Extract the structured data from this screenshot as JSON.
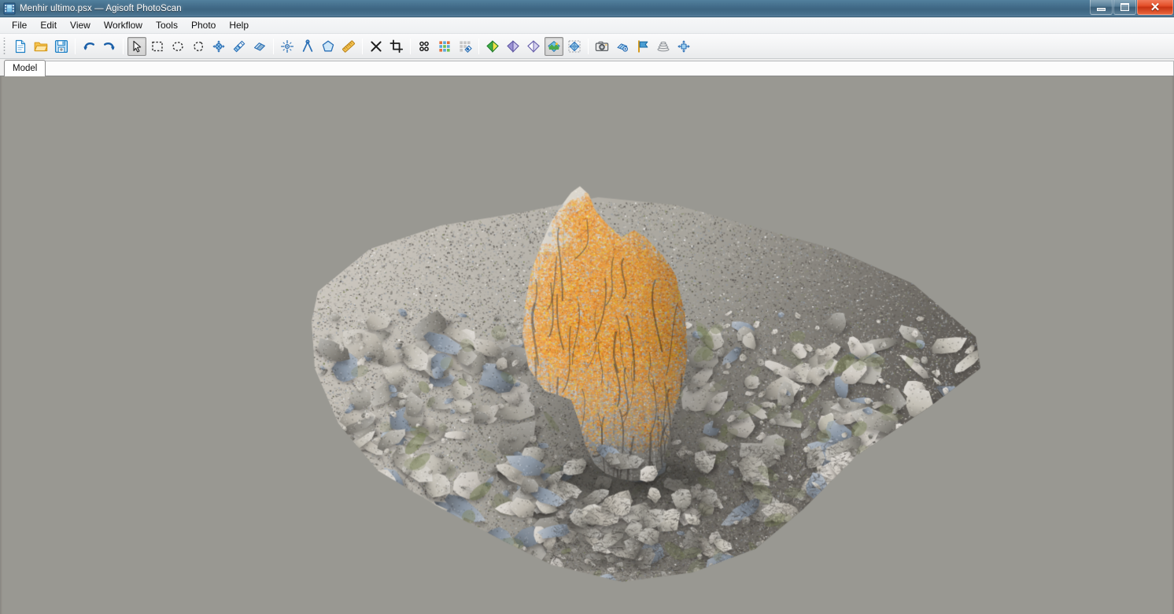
{
  "window": {
    "title": "Menhir ultimo.psx — Agisoft PhotoScan",
    "app_icon": "photoscan-document-icon",
    "controls": {
      "minimize": "Minimize",
      "maximize": "Restore",
      "close": "Close",
      "close_glyph": "✕"
    },
    "accent_title_bar": "#46718e",
    "accent_close": "#c73313"
  },
  "menu": {
    "items": [
      {
        "label": "File",
        "name": "menu-file"
      },
      {
        "label": "Edit",
        "name": "menu-edit"
      },
      {
        "label": "View",
        "name": "menu-view"
      },
      {
        "label": "Workflow",
        "name": "menu-workflow"
      },
      {
        "label": "Tools",
        "name": "menu-tools"
      },
      {
        "label": "Photo",
        "name": "menu-photo"
      },
      {
        "label": "Help",
        "name": "menu-help"
      }
    ]
  },
  "toolbar": {
    "groups": [
      {
        "name": "file-group",
        "buttons": [
          {
            "icon": "new-document-icon",
            "tooltip": "New"
          },
          {
            "icon": "open-folder-icon",
            "tooltip": "Open"
          },
          {
            "icon": "save-floppy-icon",
            "tooltip": "Save"
          }
        ]
      },
      {
        "name": "history-group",
        "buttons": [
          {
            "icon": "undo-arrow-icon",
            "tooltip": "Undo"
          },
          {
            "icon": "redo-arrow-icon",
            "tooltip": "Redo"
          }
        ]
      },
      {
        "name": "selection-group",
        "buttons": [
          {
            "icon": "arrow-cursor-icon",
            "tooltip": "Navigation",
            "active": true
          },
          {
            "icon": "rectangle-selection-icon",
            "tooltip": "Rectangle Selection"
          },
          {
            "icon": "circle-selection-icon",
            "tooltip": "Circle Selection"
          },
          {
            "icon": "free-form-selection-icon",
            "tooltip": "Free-Form Selection"
          },
          {
            "icon": "move-object-icon",
            "tooltip": "Move Object"
          },
          {
            "icon": "rotate-object-icon",
            "tooltip": "Rotate Object"
          },
          {
            "icon": "scale-object-icon",
            "tooltip": "Scale Object"
          }
        ]
      },
      {
        "name": "marker-group",
        "buttons": [
          {
            "icon": "add-marker-icon",
            "tooltip": "Place Marker"
          },
          {
            "icon": "add-scalebar-icon",
            "tooltip": "Create Scale Bar"
          },
          {
            "icon": "polygon-shape-icon",
            "tooltip": "Draw Polygon"
          },
          {
            "icon": "ruler-measure-icon",
            "tooltip": "Measure"
          }
        ]
      },
      {
        "name": "edit-group",
        "buttons": [
          {
            "icon": "delete-x-icon",
            "tooltip": "Delete Selection"
          },
          {
            "icon": "crop-selection-icon",
            "tooltip": "Crop Selection"
          }
        ]
      },
      {
        "name": "photos-group",
        "buttons": [
          {
            "icon": "show-cameras-icon",
            "tooltip": "Show Cameras"
          },
          {
            "icon": "show-aligned-photos-icon",
            "tooltip": "Show Aligned Photos"
          },
          {
            "icon": "show-matches-icon",
            "tooltip": "Show Matches"
          }
        ]
      },
      {
        "name": "view-mode-group",
        "buttons": [
          {
            "icon": "point-cloud-diamond-icon",
            "tooltip": "Point Cloud",
            "color": "#35a046"
          },
          {
            "icon": "dense-cloud-diamond-icon",
            "tooltip": "Dense Cloud",
            "color": "#8f86c9"
          },
          {
            "icon": "mesh-wireframe-diamond-icon",
            "tooltip": "Shaded Model",
            "color": "#c7c4e6"
          },
          {
            "icon": "textured-model-icon",
            "tooltip": "Textured Model",
            "active": true
          },
          {
            "icon": "tiled-model-icon",
            "tooltip": "Tiled Model"
          }
        ]
      },
      {
        "name": "capture-group",
        "buttons": [
          {
            "icon": "camera-capture-icon",
            "tooltip": "Capture View"
          },
          {
            "icon": "region-reset-icon",
            "tooltip": "Reset Region"
          },
          {
            "icon": "flag-marker-icon",
            "tooltip": "Markers"
          },
          {
            "icon": "layers-stack-icon",
            "tooltip": "Show Layers"
          },
          {
            "icon": "fit-to-view-icon",
            "tooltip": "Reset View"
          }
        ]
      }
    ]
  },
  "tabs": {
    "items": [
      {
        "label": "Model",
        "name": "tab-model",
        "selected": true
      }
    ]
  },
  "viewport": {
    "name": "model-3d-viewport",
    "background_color": "#999892",
    "model_name": "menhir-textured-mesh",
    "description": "Textured 3D photogrammetry mesh of an upright menhir standing stone covered in bright orange lichen, set on an irregular patch of grey limestone rubble and dry grass ground",
    "colors": {
      "background": "#999892",
      "lichen_orange": "#e8821a",
      "lichen_yellow": "#e8c020",
      "stone_light": "#cfcac2",
      "stone_mid": "#a8a59d",
      "stone_dark": "#6e6a64",
      "stone_blue_grey": "#8c98a6",
      "moss_green": "#6f7a47",
      "soil_dark": "#4a4642"
    }
  }
}
